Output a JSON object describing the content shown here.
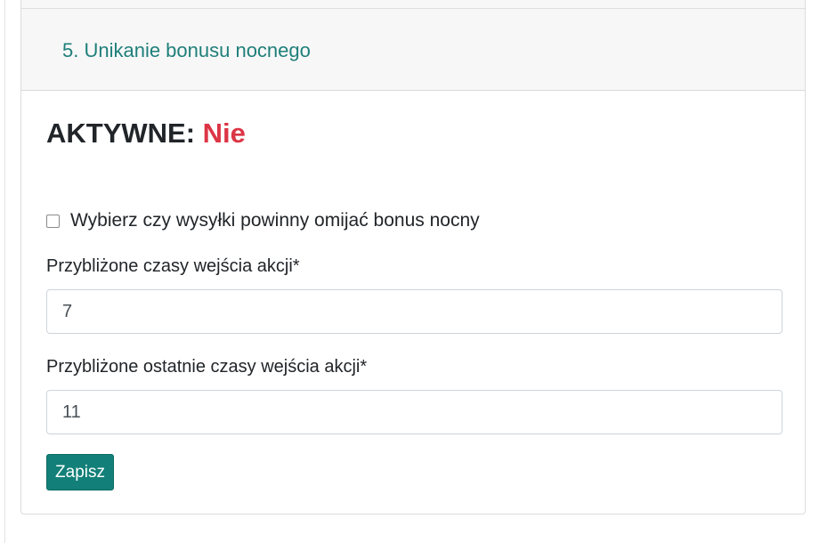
{
  "section": {
    "title": "5. Unikanie bonusu nocnego"
  },
  "status": {
    "label": "AKTYWNE:",
    "value": "Nie",
    "value_color": "#dc3545"
  },
  "checkbox": {
    "label": "Wybierz czy wysyłki powinny omijać bonus nocny",
    "checked": false
  },
  "fields": [
    {
      "label": "Przybliżone czasy wejścia akcji*",
      "value": "7"
    },
    {
      "label": "Przybliżone ostatnie czasy wejścia akcji*",
      "value": "11"
    }
  ],
  "buttons": {
    "save_label": "Zapisz"
  },
  "colors": {
    "accent": "#128078",
    "title": "#1f7f7a"
  }
}
